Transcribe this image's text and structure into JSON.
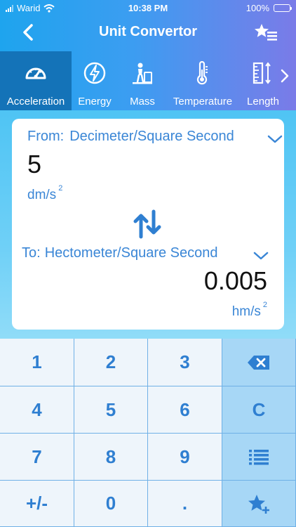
{
  "status": {
    "carrier": "Warid",
    "time": "10:38 PM",
    "battery": "100%"
  },
  "header": {
    "title": "Unit Convertor"
  },
  "tabs": [
    {
      "label": "Acceleration",
      "icon": "gauge-icon",
      "active": true
    },
    {
      "label": "Energy",
      "icon": "lightning-icon",
      "active": false
    },
    {
      "label": "Mass",
      "icon": "weight-icon",
      "active": false
    },
    {
      "label": "Temperature",
      "icon": "thermometer-icon",
      "active": false
    },
    {
      "label": "Length",
      "icon": "ruler-icon",
      "active": false
    }
  ],
  "converter": {
    "from_label": "From:",
    "from_unit": "Decimeter/Square Second",
    "from_value": "5",
    "from_symbol": "dm/s",
    "from_exp": "2",
    "to_label": "To:",
    "to_unit": "Hectometer/Square Second",
    "to_value": "0.005",
    "to_symbol": "hm/s",
    "to_exp": "2"
  },
  "keypad": {
    "k1": "1",
    "k2": "2",
    "k3": "3",
    "k4": "4",
    "k5": "5",
    "k6": "6",
    "clear": "C",
    "k7": "7",
    "k8": "8",
    "k9": "9",
    "sign": "+/-",
    "k0": "0",
    "dot": "."
  },
  "colors": {
    "accent": "#2f7fd1",
    "active_tab": "#1473b8",
    "keypad_op": "#a7d7f6"
  }
}
